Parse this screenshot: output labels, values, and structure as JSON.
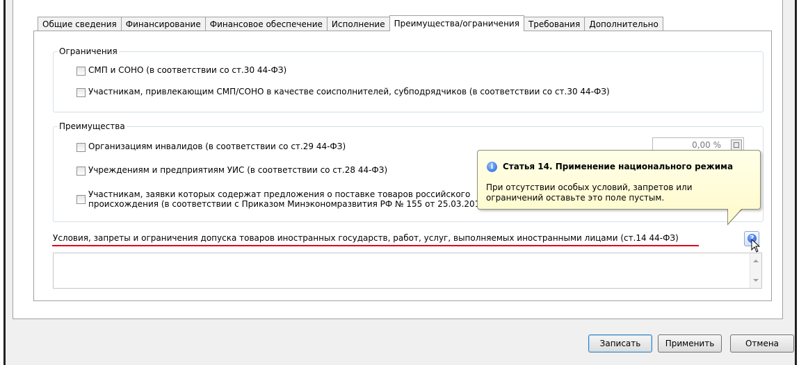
{
  "tabs": [
    {
      "label": "Общие сведения"
    },
    {
      "label": "Финансирование"
    },
    {
      "label": "Финансовое обеспечение"
    },
    {
      "label": "Исполнение"
    },
    {
      "label": "Преимущества/ограничения"
    },
    {
      "label": "Требования"
    },
    {
      "label": "Дополнительно"
    }
  ],
  "active_tab": "Преимущества/ограничения",
  "restrictions": {
    "title": "Ограничения",
    "items": [
      {
        "label": "СМП и СОНО (в соответствии со ст.30 44-ФЗ)",
        "checked": false
      },
      {
        "label": "Участникам, привлекающим СМП/СОНО в качестве соисполнителей, субподрядчиков (в соответствии со ст.30 44-ФЗ)",
        "checked": false
      }
    ]
  },
  "advantages": {
    "title": "Преимущества",
    "items": [
      {
        "label": "Организациям инвалидов (в соответствии со ст.29 44-ФЗ)",
        "checked": false
      },
      {
        "label": "Учреждениям и предприятиям УИС (в соответствии со ст.28 44-ФЗ)",
        "checked": false
      },
      {
        "label_line1": "Участникам, заявки которых содержат предложения о поставке товаров российского",
        "label_line2": "происхождения (в соответствии с Приказом Минэкономразвития РФ № 155 от 25.03.201",
        "checked": false
      }
    ],
    "percent_value": "0,00 %"
  },
  "foreign_conditions": {
    "label": "Условия, запреты и ограничения допуска товаров иностранных государств, работ, услуг, выполняемых иностранными лицами (ст.14 44-ФЗ)",
    "value": ""
  },
  "tooltip": {
    "title": "Статья 14. Применение национального режима",
    "text_line1": "При отсутствии особых условий, запретов или",
    "text_line2": "ограничений оставьте это поле пустым."
  },
  "help_icon_glyph": "?",
  "info_icon_glyph": "i",
  "buttons": {
    "save": "Записать",
    "apply": "Применить",
    "cancel": "Отмена"
  },
  "colors": {
    "annotation_underline": "#e0001b",
    "tooltip_bg": "#fffbd0"
  }
}
